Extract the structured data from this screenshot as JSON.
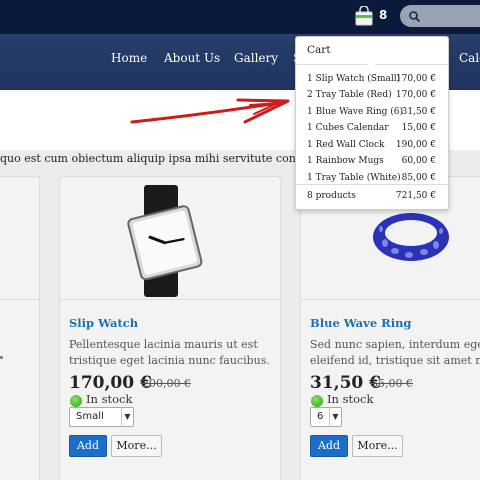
{
  "header": {
    "cart_count": "8"
  },
  "nav": {
    "items": [
      "Home",
      "About Us",
      "Gallery",
      "S",
      "Cale"
    ]
  },
  "intro_text": "quo est cum obiectum aliquip ipsa mihi servitute coniunx",
  "cart": {
    "title": "Cart",
    "items": [
      {
        "name": "1 Slip Watch (Small)",
        "price": "170,00 €"
      },
      {
        "name": "2 Tray Table (Red)",
        "price": "170,00 €"
      },
      {
        "name": "1 Blue Wave Ring (6)",
        "price": "31,50 €"
      },
      {
        "name": "1 Cubes Calendar",
        "price": "15,00 €"
      },
      {
        "name": "1 Red Wall Clock",
        "price": "190,00 €"
      },
      {
        "name": "1 Rainbow Mugs",
        "price": "60,00 €"
      },
      {
        "name": "1 Tray Table (White)",
        "price": "85,00 €"
      }
    ],
    "total_label": "8 products",
    "total": "721,50 €"
  },
  "products": [
    {
      "title": "Slip Watch",
      "desc_line1": "Pellentesque lacinia mauris ut est",
      "desc_line2": "tristique eget lacinia nunc faucibus.",
      "price": "170,00 €",
      "old_price": "200,00 €",
      "stock": "In stock",
      "option": "Small",
      "add_label": "Add",
      "more_label": "More..."
    },
    {
      "title": "Blue Wave Ring",
      "desc_line1": "Sed nunc sapien, interdum eget",
      "desc_line2": "eleifend id, tristique sit amet nec",
      "price": "31,50 €",
      "old_price": "35,00 €",
      "stock": "In stock",
      "option": "6",
      "add_label": "Add",
      "more_label": "More..."
    }
  ],
  "colors": {
    "topbar": "#0b1a3a",
    "navbar": "#1f3360",
    "link": "#1a6fb5",
    "add_button": "#1c6fc9",
    "stock_green": "#2ea318",
    "annotation_red": "#d11a1a"
  }
}
